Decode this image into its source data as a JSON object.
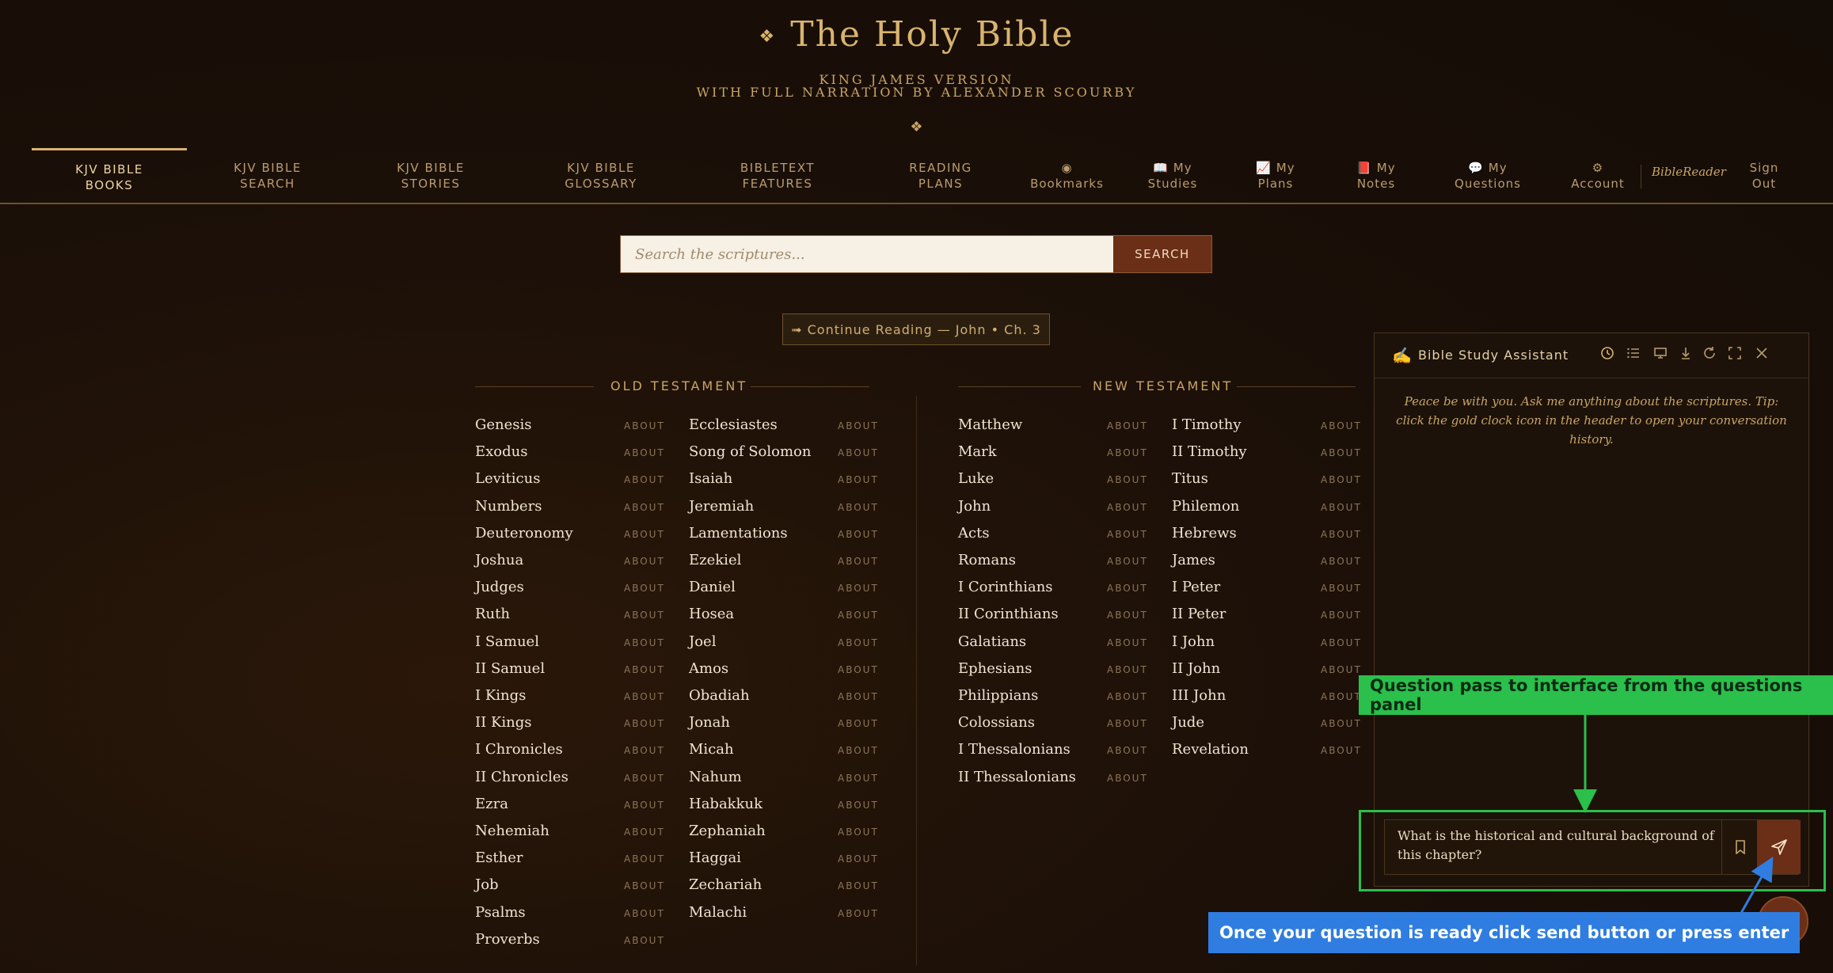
{
  "header": {
    "ornament": "❖",
    "title": "The Holy Bible",
    "subtitle1": "KING JAMES VERSION",
    "subtitle2": "WITH FULL NARRATION BY ALEXANDER SCOURBY",
    "divider": "❖"
  },
  "nav": {
    "items": [
      {
        "label": "KJV BIBLE\nBOOKS"
      },
      {
        "label": "KJV BIBLE\nSEARCH"
      },
      {
        "label": "KJV BIBLE\nSTORIES"
      },
      {
        "label": "KJV BIBLE\nGLOSSARY"
      },
      {
        "label": "BIBLETEXT\nFEATURES"
      },
      {
        "label": "READING\nPLANS"
      },
      {
        "label": "◉\nBookmarks"
      },
      {
        "label": "📖 My\nStudies"
      },
      {
        "label": "📈 My\nPlans"
      },
      {
        "label": "📕 My\nNotes"
      },
      {
        "label": "💬 My\nQuestions"
      },
      {
        "label": "⚙\nAccount"
      }
    ],
    "brand": "BibleReader",
    "signout": "Sign\nOut"
  },
  "search": {
    "placeholder": "Search the scriptures...",
    "button": "SEARCH"
  },
  "continue_reading": "➟ Continue Reading — John • Ch. 3",
  "about_label": "ABOUT",
  "old_testament": {
    "heading": "OLD TESTAMENT",
    "col1": [
      "Genesis",
      "Exodus",
      "Leviticus",
      "Numbers",
      "Deuteronomy",
      "Joshua",
      "Judges",
      "Ruth",
      "I Samuel",
      "II Samuel",
      "I Kings",
      "II Kings",
      "I Chronicles",
      "II Chronicles",
      "Ezra",
      "Nehemiah",
      "Esther",
      "Job",
      "Psalms",
      "Proverbs"
    ],
    "col2": [
      "Ecclesiastes",
      "Song of Solomon",
      "Isaiah",
      "Jeremiah",
      "Lamentations",
      "Ezekiel",
      "Daniel",
      "Hosea",
      "Joel",
      "Amos",
      "Obadiah",
      "Jonah",
      "Micah",
      "Nahum",
      "Habakkuk",
      "Zephaniah",
      "Haggai",
      "Zechariah",
      "Malachi"
    ]
  },
  "new_testament": {
    "heading": "NEW TESTAMENT",
    "col1": [
      "Matthew",
      "Mark",
      "Luke",
      "John",
      "Acts",
      "Romans",
      "I Corinthians",
      "II Corinthians",
      "Galatians",
      "Ephesians",
      "Philippians",
      "Colossians",
      "I Thessalonians",
      "II Thessalonians"
    ],
    "col2": [
      "I Timothy",
      "II Timothy",
      "Titus",
      "Philemon",
      "Hebrews",
      "James",
      "I Peter",
      "II Peter",
      "I John",
      "II John",
      "III John",
      "Jude",
      "Revelation"
    ]
  },
  "assistant": {
    "icon": "writing-hand-icon",
    "title": "Bible Study Assistant",
    "greeting": "Peace be with you. Ask me anything about the scriptures. Tip: click the gold clock icon in the header to open your conversation history.",
    "question": "What is the historical and cultural background of this chapter?"
  },
  "annotations": {
    "green": "Question pass to interface from the questions panel",
    "blue": "Once your question is ready click send button or press enter"
  },
  "colors": {
    "accent": "#d9b36f",
    "button": "#6b2e17",
    "annotation_green": "#2bbf4b",
    "annotation_blue": "#2f7de0"
  }
}
